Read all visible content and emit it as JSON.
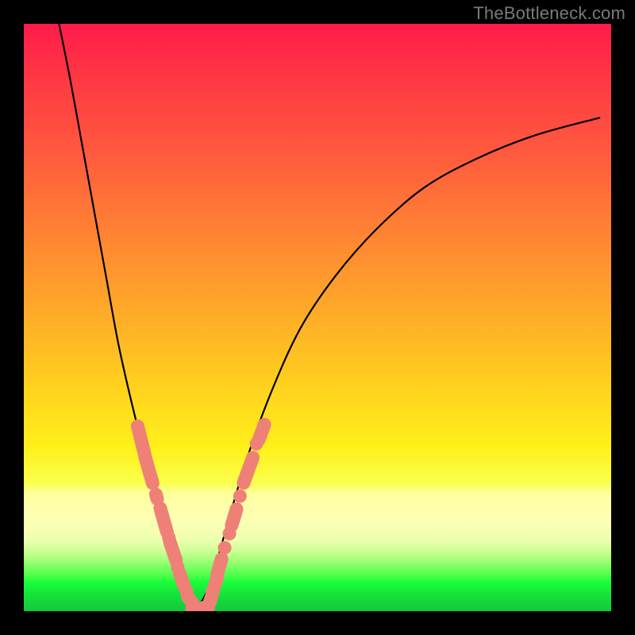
{
  "watermark": "TheBottleneck.com",
  "colors": {
    "frame": "#000000",
    "curve": "#000000",
    "marker": "#ef8078"
  },
  "chart_data": {
    "type": "line",
    "title": "",
    "xlabel": "",
    "ylabel": "",
    "xlim": [
      0,
      100
    ],
    "ylim": [
      0,
      100
    ],
    "grid": false,
    "legend": false,
    "note": "Axes are unlabeled in the source image; values are estimated on a 0–100 percentage scale read from the plot area.",
    "series": [
      {
        "name": "left-branch",
        "x": [
          6,
          8,
          10,
          12,
          14,
          16,
          18,
          20,
          22,
          24,
          25,
          26,
          27,
          28,
          29.5
        ],
        "y": [
          100,
          90,
          79,
          68,
          57,
          46,
          37,
          29,
          22,
          15,
          11,
          8,
          5,
          2.5,
          0.5
        ]
      },
      {
        "name": "right-branch",
        "x": [
          29.5,
          31,
          33,
          35,
          38,
          42,
          47,
          53,
          60,
          68,
          77,
          87,
          98
        ],
        "y": [
          0.5,
          3,
          9,
          16,
          26,
          37,
          48,
          57,
          65,
          72,
          77,
          81,
          84
        ]
      }
    ],
    "markers_left": [
      {
        "x": 20.0,
        "y": 29.0,
        "len": 3.5
      },
      {
        "x": 21.3,
        "y": 24.0,
        "len": 3.2
      },
      {
        "x": 22.6,
        "y": 19.5,
        "len": 1.2
      },
      {
        "x": 23.8,
        "y": 15.5,
        "len": 3.0
      },
      {
        "x": 24.7,
        "y": 12.5,
        "len": 0.9
      },
      {
        "x": 25.4,
        "y": 10.2,
        "len": 2.5
      },
      {
        "x": 26.2,
        "y": 7.5,
        "len": 1.0
      },
      {
        "x": 26.9,
        "y": 5.4,
        "len": 2.0
      },
      {
        "x": 27.7,
        "y": 3.4,
        "len": 0.9
      },
      {
        "x": 28.4,
        "y": 1.8,
        "len": 1.6
      }
    ],
    "markers_bottom": [
      {
        "x": 29.0,
        "y": 0.6,
        "len": 1.0
      },
      {
        "x": 29.8,
        "y": 0.4,
        "len": 2.0
      },
      {
        "x": 31.0,
        "y": 0.6,
        "len": 1.2
      }
    ],
    "markers_right": [
      {
        "x": 31.8,
        "y": 2.0,
        "len": 1.4
      },
      {
        "x": 32.5,
        "y": 4.4,
        "len": 2.2
      },
      {
        "x": 33.3,
        "y": 7.6,
        "len": 2.2
      },
      {
        "x": 34.2,
        "y": 10.8,
        "len": 0.9
      },
      {
        "x": 35.0,
        "y": 13.2,
        "len": 0.9
      },
      {
        "x": 35.8,
        "y": 16.0,
        "len": 2.3
      },
      {
        "x": 36.8,
        "y": 19.6,
        "len": 0.9
      },
      {
        "x": 38.2,
        "y": 24.0,
        "len": 3.2
      },
      {
        "x": 39.6,
        "y": 28.5,
        "len": 0.9
      },
      {
        "x": 40.5,
        "y": 30.5,
        "len": 2.2
      }
    ]
  }
}
